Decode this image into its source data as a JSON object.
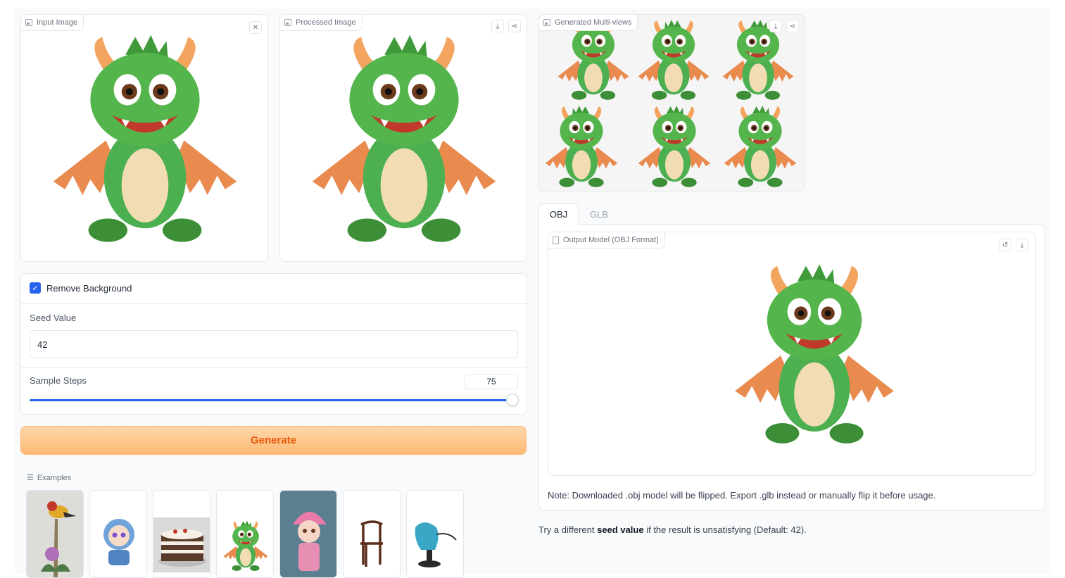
{
  "input_panel": {
    "label": "Input Image",
    "clear_icon": "close-icon"
  },
  "processed_panel": {
    "label": "Processed Image"
  },
  "multiview_panel": {
    "label": "Generated Multi-views"
  },
  "options": {
    "remove_background_label": "Remove Background",
    "remove_background_checked": true,
    "seed_label": "Seed Value",
    "seed_value": "42",
    "steps_label": "Sample Steps",
    "steps_value": "75",
    "steps_fraction": 1.0
  },
  "generate_label": "Generate",
  "examples": {
    "label": "Examples",
    "items": [
      "bird-on-thistle",
      "hooded-chibi-figure",
      "layer-cake",
      "green-dragon",
      "pink-hat-girl",
      "wooden-chair",
      "blue-armchair"
    ]
  },
  "output": {
    "tabs": [
      "OBJ",
      "GLB"
    ],
    "active_tab": "OBJ",
    "model_label": "Output Model (OBJ Format)",
    "note": "Note: Downloaded .obj model will be flipped. Export .glb instead or manually flip it before usage."
  },
  "hint": {
    "prefix": "Try a different ",
    "bold": "seed value",
    "suffix": " if the result is unsatisfying (Default: 42)."
  },
  "colors": {
    "accent": "#2563eb",
    "generate_bg": "#fdba74",
    "generate_text": "#ea580c",
    "dragon": "#4caf50"
  }
}
